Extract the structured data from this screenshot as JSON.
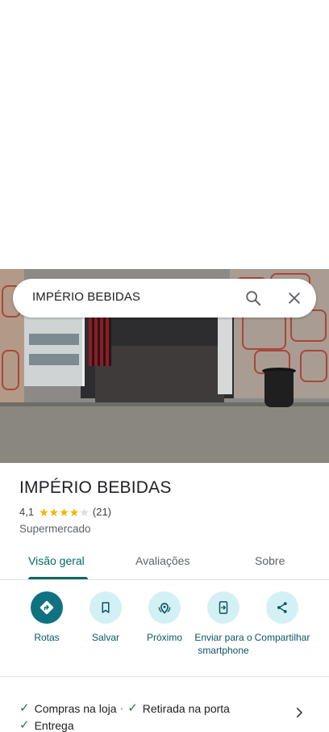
{
  "search": {
    "query": "IMPÉRIO BEBIDAS"
  },
  "place": {
    "name": "IMPÉRIO BEBIDAS",
    "rating": "4,1",
    "rating_value": 4.1,
    "review_count": "(21)",
    "category": "Supermercado"
  },
  "tabs": [
    {
      "label": "Visão geral"
    },
    {
      "label": "Avaliações"
    },
    {
      "label": "Sobre"
    }
  ],
  "actions": [
    {
      "label": "Rotas",
      "icon": "directions-icon"
    },
    {
      "label": "Salvar",
      "icon": "bookmark-icon"
    },
    {
      "label": "Próximo",
      "icon": "nearby-icon"
    },
    {
      "label": "Enviar para o smartphone",
      "icon": "send-to-phone-icon"
    },
    {
      "label": "Compartilhar",
      "icon": "share-icon"
    }
  ],
  "features": [
    {
      "label": "Compras na loja"
    },
    {
      "label": "Retirada na porta"
    },
    {
      "label": "Entrega"
    }
  ],
  "features_separator": "·",
  "colors": {
    "accent": "#00695c",
    "action_bg": "#d3f1f4",
    "primary_action": "#0e7280",
    "star": "#f4b400",
    "check": "#188038"
  }
}
